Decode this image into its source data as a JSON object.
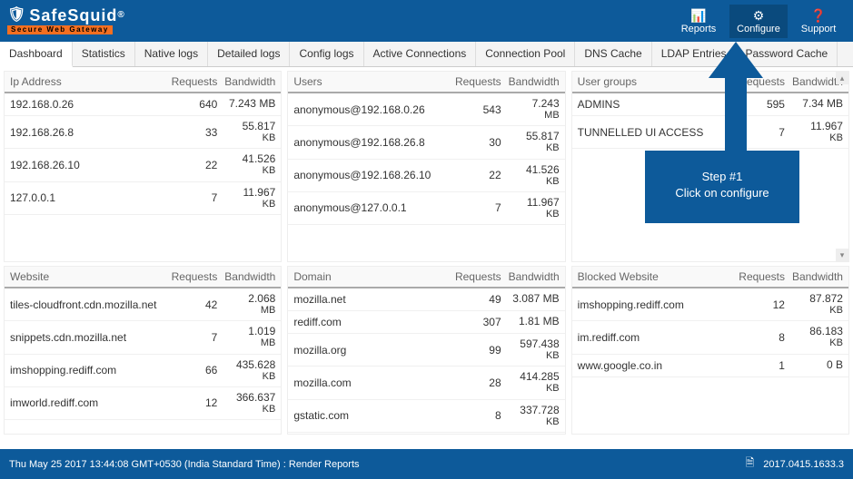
{
  "brand": {
    "name": "SafeSquid",
    "reg": "®",
    "tagline": "Secure Web Gateway"
  },
  "topnav": [
    {
      "icon": "📊",
      "label": "Reports"
    },
    {
      "icon": "⚙",
      "label": "Configure"
    },
    {
      "icon": "❓",
      "label": "Support"
    }
  ],
  "tabs": [
    "Dashboard",
    "Statistics",
    "Native logs",
    "Detailed logs",
    "Config logs",
    "Active Connections",
    "Connection Pool",
    "DNS Cache",
    "LDAP Entries",
    "Password Cache"
  ],
  "callout": {
    "title": "Step #1",
    "line": "Click on configure"
  },
  "panels_top": [
    {
      "title": "Ip Address",
      "h2": "Requests",
      "h3": "Bandwidth",
      "rows": [
        {
          "c1": "192.168.0.26",
          "c2": "640",
          "c3a": "7.243 MB",
          "c3b": ""
        },
        {
          "c1": "192.168.26.8",
          "c2": "33",
          "c3a": "55.817",
          "c3b": "KB"
        },
        {
          "c1": "192.168.26.10",
          "c2": "22",
          "c3a": "41.526",
          "c3b": "KB"
        },
        {
          "c1": "127.0.0.1",
          "c2": "7",
          "c3a": "11.967",
          "c3b": "KB"
        }
      ]
    },
    {
      "title": "Users",
      "h2": "Requests",
      "h3": "Bandwidth",
      "rows": [
        {
          "c1": "anonymous@192.168.0.26",
          "c2": "543",
          "c3a": "7.243",
          "c3b": "MB"
        },
        {
          "c1": "anonymous@192.168.26.8",
          "c2": "30",
          "c3a": "55.817",
          "c3b": "KB"
        },
        {
          "c1": "anonymous@192.168.26.10",
          "c2": "22",
          "c3a": "41.526",
          "c3b": "KB"
        },
        {
          "c1": "anonymous@127.0.0.1",
          "c2": "7",
          "c3a": "11.967",
          "c3b": "KB"
        }
      ]
    },
    {
      "title": "User groups",
      "h2": "Requests",
      "h3": "Bandwidth",
      "rows": [
        {
          "c1": "ADMINS",
          "c2": "595",
          "c3a": "7.34 MB",
          "c3b": ""
        },
        {
          "c1": "TUNNELLED UI ACCESS",
          "c2": "7",
          "c3a": "11.967",
          "c3b": "KB"
        }
      ]
    }
  ],
  "panels_bot": [
    {
      "title": "Website",
      "h2": "Requests",
      "h3": "Bandwidth",
      "rows": [
        {
          "c1": "tiles-cloudfront.cdn.mozilla.net",
          "c2": "42",
          "c3a": "2.068",
          "c3b": "MB"
        },
        {
          "c1": "snippets.cdn.mozilla.net",
          "c2": "7",
          "c3a": "1.019",
          "c3b": "MB"
        },
        {
          "c1": "imshopping.rediff.com",
          "c2": "66",
          "c3a": "435.628",
          "c3b": "KB"
        },
        {
          "c1": "imworld.rediff.com",
          "c2": "12",
          "c3a": "366.637",
          "c3b": "KB"
        }
      ]
    },
    {
      "title": "Domain",
      "h2": "Requests",
      "h3": "Bandwidth",
      "rows": [
        {
          "c1": "mozilla.net",
          "c2": "49",
          "c3a": "3.087 MB",
          "c3b": ""
        },
        {
          "c1": "rediff.com",
          "c2": "307",
          "c3a": "1.81 MB",
          "c3b": ""
        },
        {
          "c1": "mozilla.org",
          "c2": "99",
          "c3a": "597.438",
          "c3b": "KB"
        },
        {
          "c1": "mozilla.com",
          "c2": "28",
          "c3a": "414.285",
          "c3b": "KB"
        },
        {
          "c1": "gstatic.com",
          "c2": "8",
          "c3a": "337.728",
          "c3b": "KB"
        }
      ]
    },
    {
      "title": "Blocked Website",
      "h2": "Requests",
      "h3": "Bandwidth",
      "rows": [
        {
          "c1": "imshopping.rediff.com",
          "c2": "12",
          "c3a": "87.872",
          "c3b": "KB"
        },
        {
          "c1": "im.rediff.com",
          "c2": "8",
          "c3a": "86.183",
          "c3b": "KB"
        },
        {
          "c1": "www.google.co.in",
          "c2": "1",
          "c3a": "0 B",
          "c3b": ""
        }
      ]
    }
  ],
  "footer": {
    "left": "Thu May 25 2017 13:44:08 GMT+0530 (India Standard Time) : Render Reports",
    "version": "2017.0415.1633.3"
  }
}
